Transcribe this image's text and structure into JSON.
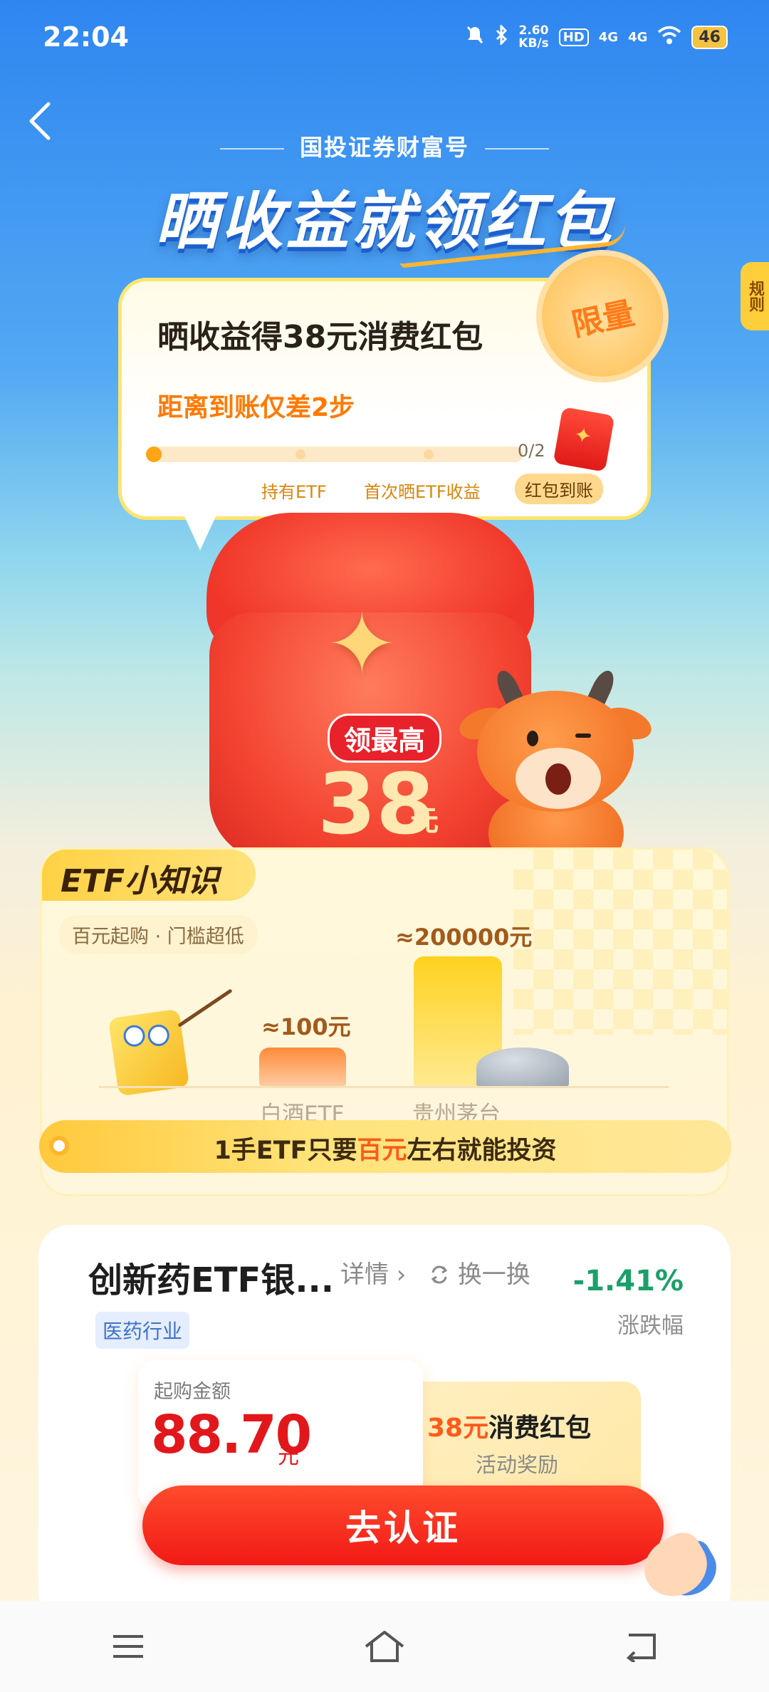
{
  "status_bar": {
    "time": "22:04",
    "net_speed": "2.60",
    "net_unit": "KB/s",
    "hd": "HD",
    "sig1": "4G",
    "sig2": "4G",
    "battery": "46"
  },
  "header": {
    "brand": "国投证券财富号",
    "title": "晒收益就领红包"
  },
  "rules_tab": "规则",
  "task_card": {
    "title": "晒收益得38元消费红包",
    "subtitle": "距离到账仅差2步",
    "badge": "限量",
    "progress_text": "0/2",
    "progress": 0,
    "steps": [
      "持有ETF",
      "首次晒ETF收益",
      "红包到账"
    ]
  },
  "packet": {
    "label": "领最高",
    "amount": "38",
    "unit": "元"
  },
  "etf_card": {
    "tab": "ETF小知识",
    "tag": "百元起购 · 门槛超低",
    "bars": [
      {
        "label": "白酒ETF",
        "value_text": "≈100元",
        "value": 100
      },
      {
        "label": "贵州茅台",
        "value_text": "≈200000元",
        "value": 200000
      }
    ],
    "banner_pre": "1手ETF只要",
    "banner_hl": "百元",
    "banner_post": "左右就能投资"
  },
  "fund": {
    "name": "创新药ETF银...",
    "detail": "详情",
    "swap": "换一换",
    "change": "-1.41%",
    "change_label": "涨跌幅",
    "tag": "医药行业",
    "buy_label": "起购金额",
    "buy_amount": "88.70",
    "buy_unit": "元",
    "reward_amount": "38元",
    "reward_text": "消费红包",
    "reward_label": "活动奖励",
    "cta": "去认证"
  },
  "colors": {
    "accent_red": "#f11a16",
    "gain_green": "#1c9f6a",
    "accent_orange": "#ff7a00"
  }
}
